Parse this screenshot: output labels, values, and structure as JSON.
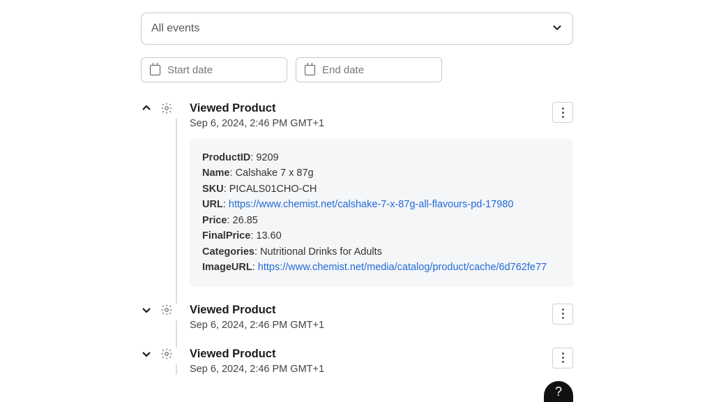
{
  "filter": {
    "label": "All events"
  },
  "dates": {
    "start_placeholder": "Start date",
    "end_placeholder": "End date"
  },
  "events": [
    {
      "title": "Viewed Product",
      "timestamp": "Sep 6, 2024, 2:46 PM GMT+1",
      "expanded": true,
      "details": {
        "labels": {
          "product_id": "ProductID",
          "name": "Name",
          "sku": "SKU",
          "url": "URL",
          "price": "Price",
          "final_price": "FinalPrice",
          "categories": "Categories",
          "image_url": "ImageURL"
        },
        "values": {
          "product_id": "9209",
          "name": "Calshake 7 x 87g",
          "sku": "PICALS01CHO-CH",
          "url": "https://www.chemist.net/calshake-7-x-87g-all-flavours-pd-17980",
          "price": "26.85",
          "final_price": "13.60",
          "categories": "Nutritional Drinks for Adults",
          "image_url": "https://www.chemist.net/media/catalog/product/cache/6d762fe77"
        }
      }
    },
    {
      "title": "Viewed Product",
      "timestamp": "Sep 6, 2024, 2:46 PM GMT+1",
      "expanded": false
    },
    {
      "title": "Viewed Product",
      "timestamp": "Sep 6, 2024, 2:46 PM GMT+1",
      "expanded": false
    }
  ],
  "help": {
    "label": "?"
  }
}
